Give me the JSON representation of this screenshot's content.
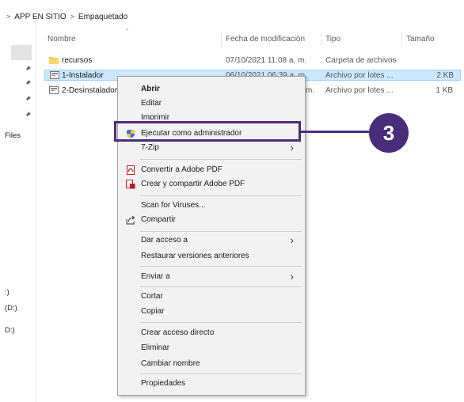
{
  "breadcrumb": {
    "items": [
      "APP EN SITIO",
      "Empaquetado"
    ]
  },
  "nav": {
    "labels": [
      "Files",
      ":)",
      "(D:)",
      "D:)"
    ]
  },
  "columns": {
    "name": "Nombre",
    "modified": "Fecha de modificación",
    "type": "Tipo",
    "size": "Tamaño"
  },
  "files": [
    {
      "name": "recursos",
      "modified": "07/10/2021 11:08 a. m.",
      "type": "Carpeta de archivos",
      "size": ""
    },
    {
      "name": "1-Instalador",
      "modified": "06/10/2021 06:39 a. m.",
      "type": "Archivo por lotes ...",
      "size": "2 KB"
    },
    {
      "name": "2-Desinstalador",
      "modified": "m.",
      "type": "Archivo por lotes ...",
      "size": "1 KB"
    }
  ],
  "context_menu": {
    "abrir": "Abrir",
    "editar": "Editar",
    "imprimir": "Imprimir",
    "ejecutar_admin": "Ejecutar como administrador",
    "zip": "7-Zip",
    "convertir_pdf": "Convertir a Adobe PDF",
    "compartir_pdf": "Crear y compartir Adobe PDF",
    "scan": "Scan for Viruses...",
    "compartir": "Compartir",
    "dar_acceso": "Dar acceso a",
    "restaurar": "Restaurar versiones anteriores",
    "enviar": "Enviar a",
    "cortar": "Cortar",
    "copiar": "Copiar",
    "acceso_directo": "Crear acceso directo",
    "eliminar": "Eliminar",
    "cambiar_nombre": "Cambiar nombre",
    "propiedades": "Propiedades"
  },
  "callout": {
    "number": "3",
    "color": "#4a2d7a"
  },
  "colors": {
    "selection": "#cce8ff",
    "menu_bg": "#f2f2f2"
  }
}
